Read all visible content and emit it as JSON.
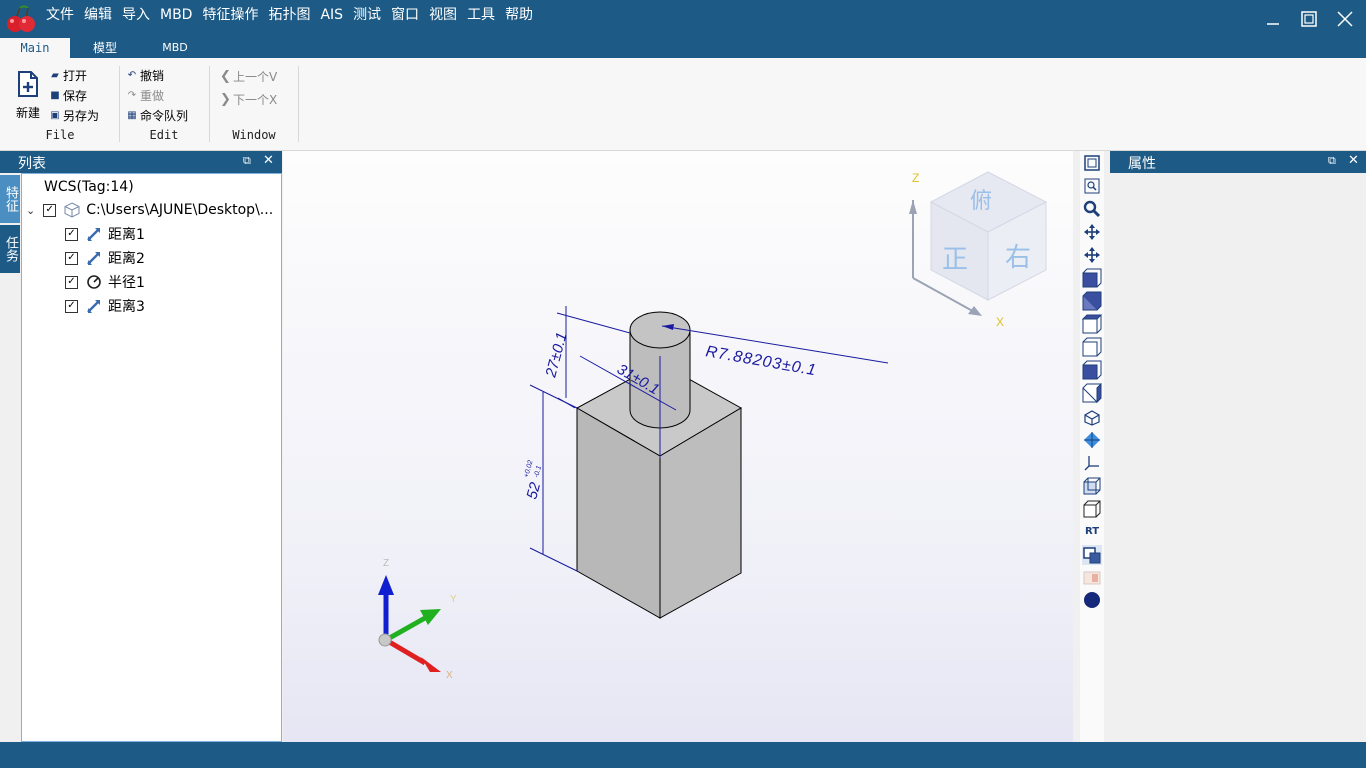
{
  "app": {
    "menu": [
      "文件",
      "编辑",
      "导入",
      "MBD",
      "特征操作",
      "拓扑图",
      "AIS",
      "测试",
      "窗口",
      "视图",
      "工具",
      "帮助"
    ]
  },
  "ribbon": {
    "tabs": [
      "Main",
      "模型",
      "MBD"
    ],
    "file": {
      "new_label": "新建",
      "open_label": "打开",
      "save_label": "保存",
      "saveas_label": "另存为",
      "group_label": "File"
    },
    "edit": {
      "undo_label": "撤销",
      "redo_label": "重做",
      "queue_label": "命令队列",
      "group_label": "Edit"
    },
    "window": {
      "prev_label": "上一个V",
      "next_label": "下一个X",
      "group_label": "Window"
    }
  },
  "left_panel": {
    "title": "列表",
    "vtabs": [
      "特征",
      "任务"
    ],
    "tree": {
      "root_label": "WCS(Tag:14)",
      "file_node": "C:\\Users\\AJUNE\\Desktop\\...",
      "children": [
        {
          "label": "距离1",
          "icon": "dimension-icon"
        },
        {
          "label": "距离2",
          "icon": "dimension-icon"
        },
        {
          "label": "半径1",
          "icon": "radius-icon"
        },
        {
          "label": "距离3",
          "icon": "dimension-icon"
        }
      ]
    }
  },
  "viewport": {
    "dims": {
      "d1": "27±0.1",
      "d2": "31±0.1",
      "d3_base": "52",
      "d3_sup": "+0.02",
      "d3_sub": "-0.1",
      "radius": "R7.88203±0.1"
    },
    "viewcube": {
      "top": "俯",
      "front": "正",
      "right": "右",
      "axis_z": "Z",
      "axis_x": "X"
    },
    "triad": {
      "x": "X",
      "y": "Y",
      "z": "Z"
    },
    "triad_colors": {
      "x": "#e02020",
      "y": "#20b020",
      "z": "#1020d0"
    }
  },
  "right_toolbar": {
    "rt_label": "RT",
    "icons": [
      "fit-all-icon",
      "zoom-window-icon",
      "zoom-icon",
      "pan-icon",
      "rotate-icon",
      "view-front-icon",
      "view-back-icon",
      "view-top-icon",
      "view-bottom-icon",
      "view-left-icon",
      "view-right-icon",
      "view-iso-icon",
      "shaded-icon",
      "axes-icon",
      "wireframe-icon",
      "box-icon",
      "rt-icon",
      "selection-icon",
      "material-icon",
      "color-icon"
    ]
  },
  "properties_panel": {
    "title": "属性"
  },
  "colors": {
    "primary": "#1d5b86",
    "ribbon_bg": "#f7f7f7"
  }
}
